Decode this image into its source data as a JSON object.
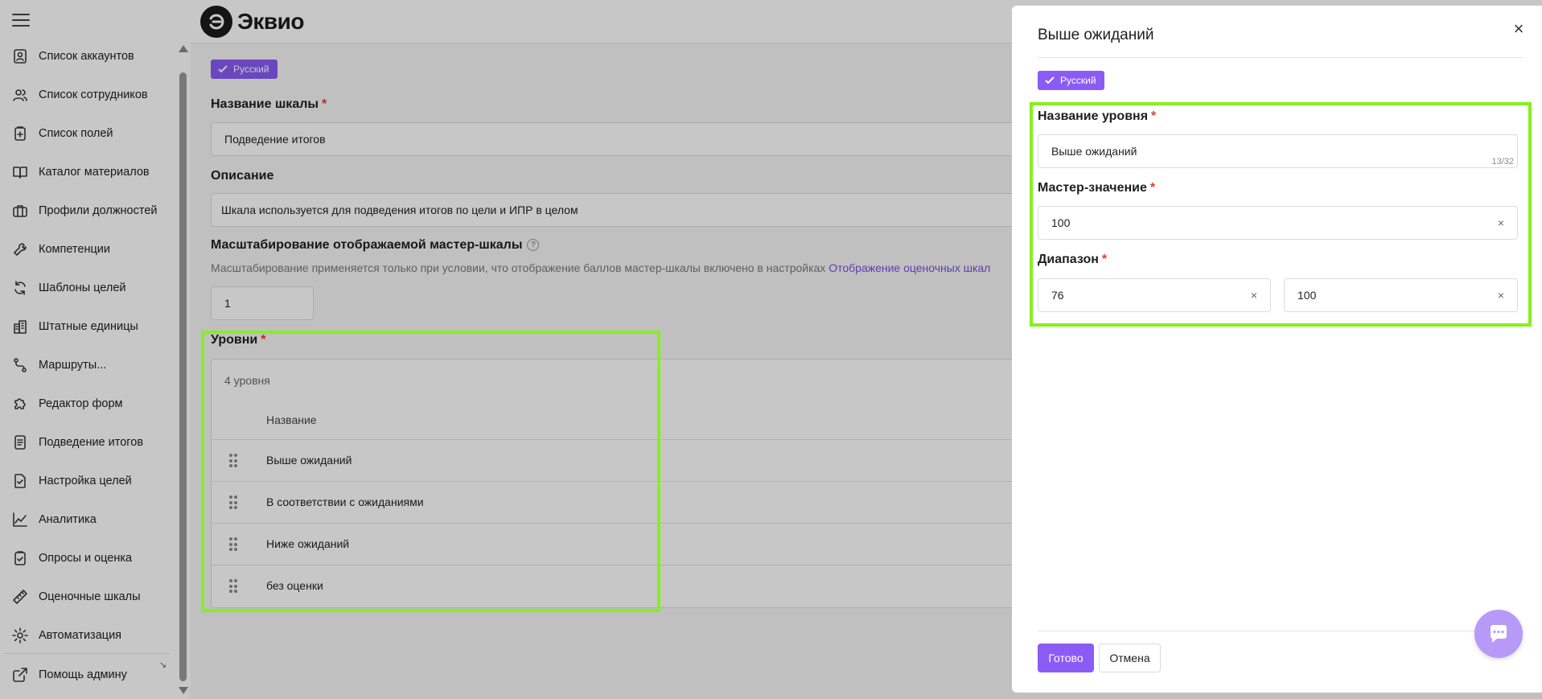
{
  "app": {
    "logo_text": "Эквио"
  },
  "sidebar": {
    "items": [
      {
        "label": "Список аккаунтов",
        "icon": "account-list-icon"
      },
      {
        "label": "Список сотрудников",
        "icon": "users-icon"
      },
      {
        "label": "Список полей",
        "icon": "fields-icon"
      },
      {
        "label": "Каталог материалов",
        "icon": "book-icon"
      },
      {
        "label": "Профили должностей",
        "icon": "briefcase-icon"
      },
      {
        "label": "Компетенции",
        "icon": "wrench-icon"
      },
      {
        "label": "Шаблоны целей",
        "icon": "refresh-icon"
      },
      {
        "label": "Штатные единицы",
        "icon": "building-icon"
      },
      {
        "label": "Маршруты...",
        "icon": "route-icon"
      },
      {
        "label": "Редактор форм",
        "icon": "puzzle-icon"
      },
      {
        "label": "Подведение итогов",
        "icon": "document-icon"
      },
      {
        "label": "Настройка целей",
        "icon": "checklist-icon"
      },
      {
        "label": "Аналитика",
        "icon": "chart-icon"
      },
      {
        "label": "Опросы и оценка",
        "icon": "survey-icon"
      },
      {
        "label": "Оценочные шкалы",
        "icon": "ruler-icon"
      },
      {
        "label": "Автоматизация",
        "icon": "gear-icon"
      }
    ],
    "bottom": {
      "label": "Помощь админу",
      "icon": "external-link-icon"
    }
  },
  "form": {
    "lang_badge": "Русский",
    "scale_name_label": "Название шкалы",
    "scale_name_value": "Подведение итогов",
    "description_label": "Описание",
    "description_value": "Шкала используется для подведения итогов по цели и ИПР в целом",
    "scaling_label": "Масштабирование отображаемой мастер-шкалы",
    "scaling_hint": "Масштабирование применяется только при условии, что отображение баллов мастер-шкалы включено в настройках",
    "scaling_link": "Отображение оценочных шкал",
    "scaling_value": "1",
    "levels_label": "Уровни",
    "levels_count": "4 уровня",
    "levels_column": "Название",
    "levels": [
      "Выше ожиданий",
      "В соответствии с ожиданиями",
      "Ниже ожиданий",
      "без оценки"
    ]
  },
  "drawer": {
    "title": "Выше ожиданий",
    "lang_badge": "Русский",
    "level_name_label": "Название уровня",
    "level_name_value": "Выше ожиданий",
    "level_name_counter": "13/32",
    "master_label": "Мастер-значение",
    "master_value": "100",
    "range_label": "Диапазон",
    "range_from": "76",
    "range_to": "100",
    "done_label": "Готово",
    "cancel_label": "Отмена",
    "close_symbol": "×",
    "clear_symbol": "×",
    "required_mark": "*"
  },
  "colors": {
    "accent": "#8a5cf5",
    "highlight": "#86f01e",
    "required": "#e53935",
    "link": "#7b4fe0"
  }
}
